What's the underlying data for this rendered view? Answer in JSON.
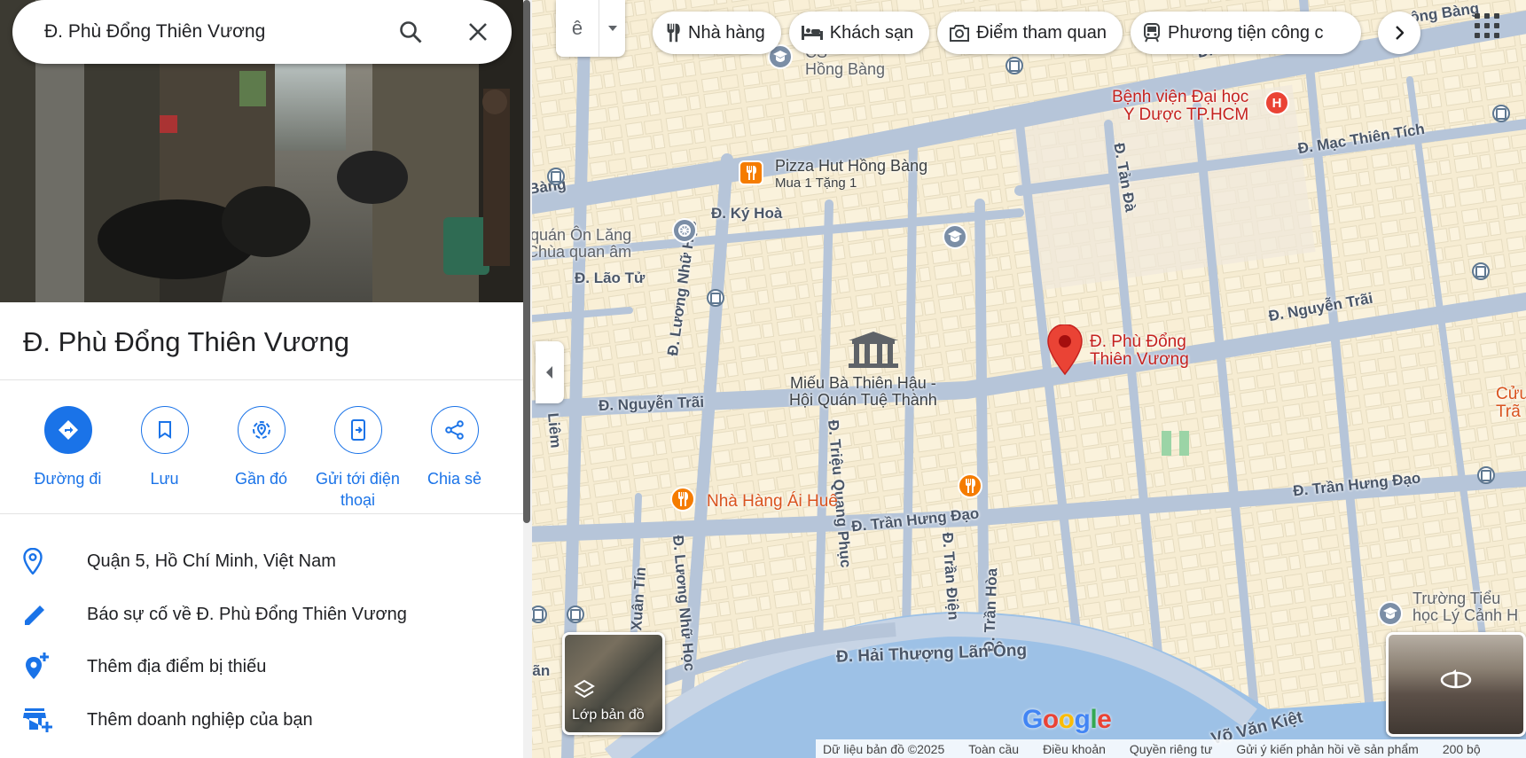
{
  "search": {
    "value": "Đ. Phù Đổng Thiên Vương"
  },
  "place": {
    "title": "Đ. Phù Đổng Thiên Vương"
  },
  "actions": [
    {
      "label": "Đường đi",
      "icon": "directions-icon"
    },
    {
      "label": "Lưu",
      "icon": "bookmark-icon"
    },
    {
      "label": "Gần đó",
      "icon": "nearby-icon"
    },
    {
      "label": "Gửi tới điện thoại",
      "icon": "send-to-phone-icon"
    },
    {
      "label": "Chia sẻ",
      "icon": "share-icon"
    }
  ],
  "info": [
    {
      "text": "Quận 5, Hồ Chí Minh, Việt Nam",
      "icon": "location-pin-icon"
    },
    {
      "text": "Báo sự cố về Đ. Phù Đổng Thiên Vương",
      "icon": "edit-pencil-icon"
    },
    {
      "text": "Thêm địa điểm bị thiếu",
      "icon": "add-location-icon"
    },
    {
      "text": "Thêm doanh nghiệp của bạn",
      "icon": "add-business-icon"
    }
  ],
  "input_tool": {
    "glyph": "ê"
  },
  "chips": [
    {
      "label": "Nhà hàng",
      "icon": "restaurant-icon"
    },
    {
      "label": "Khách sạn",
      "icon": "hotel-icon"
    },
    {
      "label": "Điểm tham quan",
      "icon": "camera-icon"
    },
    {
      "label": "Phương tiện công c",
      "icon": "transit-icon"
    }
  ],
  "map": {
    "streets": {
      "hong_bang_top": "Đ. Hồng",
      "hong_bang_left": "Bàng",
      "mac_thien_tich": "Đ. Mạc Thiên Tích",
      "ky_hoa": "Đ. Ký Hoà",
      "lao_tu": "Đ. Lão Tử",
      "luong_nhu_hoc_top": "Đ. Lương Nhữ Học",
      "nguyen_trai_left": "Đ. Nguyễn Trãi",
      "nguyen_trai_right": "Đ. Nguyễn Trãi",
      "tan_da": "Đ. Tản Đà",
      "tran_hung_dao_left": "Đ. Trần Hưng Đạo",
      "tran_hung_dao_right": "Đ. Trần Hưng Đạo",
      "trieu_quang_phuc": "Đ. Triệu Quang Phục",
      "luong_nhu_hoc_bottom": "Đ. Lương Nhữ Học",
      "luu_xuan_tin": "Đ. Lưu Xuân Tín",
      "tran_dien": "Đ. Trần Điện",
      "tran_hoa": "Đ. Trần Hòa",
      "hai_thuong_lan_ong": "Đ. Hải Thượng Lãn Ông",
      "vo_van_kiet": "Võ Văn Kiệt",
      "liem": "Liêm",
      "lan": "Lãn",
      "bang_top_right": "ông Bàng"
    },
    "pois": {
      "hospital": "Bệnh viện Đại học\nY Dược TP.HCM",
      "pizza_hut": "Pizza Hut Hồng Bàng",
      "pizza_hut_sub": "Mua 1 Tặng 1",
      "pagoda": "i quán Ôn Lăng\nChùa quan âm",
      "temple": "Miếu Bà Thiên Hậu -\nHội Quán Tuệ Thành",
      "pin": "Đ. Phù Đổng\nThiên Vương",
      "restaurant": "Nhà Hàng Ái Huê",
      "school": "Trường Tiểu\nhọc Lý Cảnh H",
      "school_top": "CS\nHồng Bàng",
      "cuu": "Cửu\nTrã"
    },
    "layers_label": "Lớp bản đồ",
    "google_logo": "Google"
  },
  "footer": {
    "items": [
      "Dữ liệu bản đồ ©2025",
      "Toàn cầu",
      "Điều khoản",
      "Quyền riêng tư",
      "Gửi ý kiến phản hồi về sản phẩm",
      "200 bộ"
    ]
  },
  "colors": {
    "accent": "#1a73e8",
    "pin": "#ea4335",
    "map_bg": "#f6ecd2",
    "road": "#b6c5d9"
  }
}
